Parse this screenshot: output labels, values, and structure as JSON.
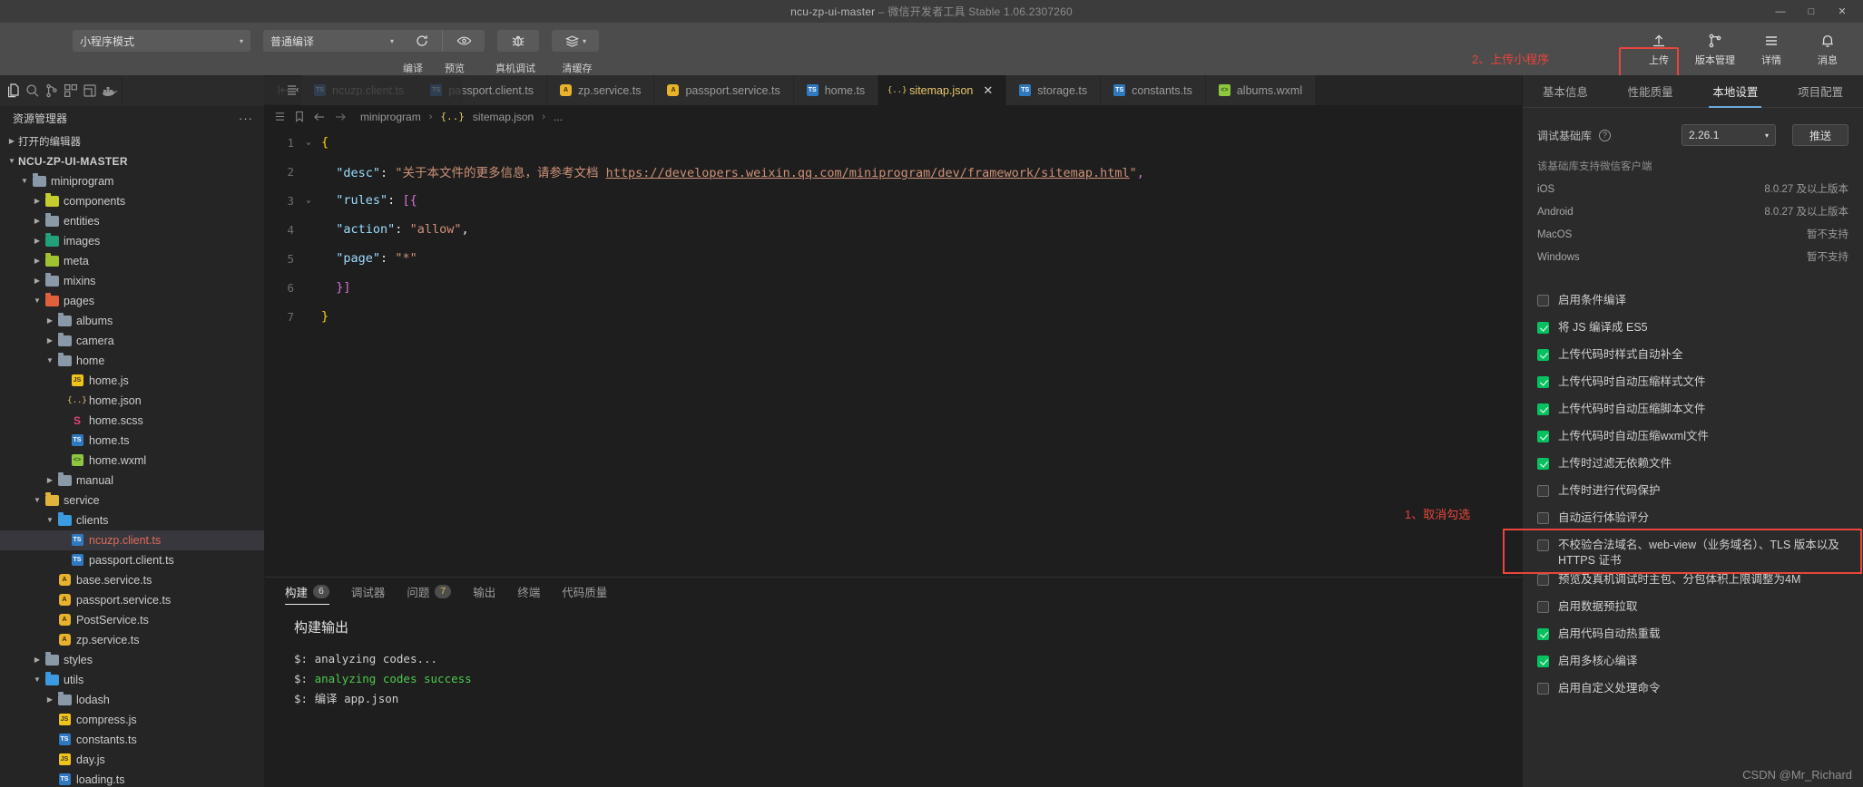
{
  "window": {
    "title_main": "ncu-zp-ui-master",
    "title_dash": " – ",
    "title_sub": "微信开发者工具 Stable 1.06.2307260",
    "minimize": "—",
    "maximize": "□",
    "close": "✕"
  },
  "toolbar": {
    "mode_select": "小程序模式",
    "compile_select": "普通编译",
    "caret": "▾",
    "labels": {
      "compile": "编译",
      "preview": "预览",
      "real_device": "真机调试",
      "clear_cache": "清缓存"
    },
    "annotation_upload": "2、上传小程序",
    "right_items": [
      {
        "icon": "upload-icon",
        "label": "上传"
      },
      {
        "icon": "branch-icon",
        "label": "版本管理"
      },
      {
        "icon": "details-icon",
        "label": "详情"
      },
      {
        "icon": "bell-icon",
        "label": "消息"
      }
    ]
  },
  "activity_bar": {
    "icons": [
      "files-icon",
      "search-icon",
      "source-control-icon",
      "extensions-icon",
      "debug-icon",
      "docker-icon",
      "collapse-all-icon"
    ]
  },
  "explorer": {
    "title": "资源管理器",
    "more": "···",
    "open_editors": "打开的编辑器",
    "root": "NCU-ZP-UI-MASTER",
    "tree": [
      {
        "label": "miniprogram",
        "depth": 1,
        "type": "folder",
        "state": "open",
        "color": "#8a99a8"
      },
      {
        "label": "components",
        "depth": 2,
        "type": "folder",
        "state": "closed",
        "color": "#c5cc2e"
      },
      {
        "label": "entities",
        "depth": 2,
        "type": "folder",
        "state": "closed",
        "color": "#8a99a8"
      },
      {
        "label": "images",
        "depth": 2,
        "type": "folder",
        "state": "closed",
        "color": "#22a07a"
      },
      {
        "label": "meta",
        "depth": 2,
        "type": "folder",
        "state": "closed",
        "color": "#9fc22e"
      },
      {
        "label": "mixins",
        "depth": 2,
        "type": "folder",
        "state": "closed",
        "color": "#8a99a8"
      },
      {
        "label": "pages",
        "depth": 2,
        "type": "folder",
        "state": "open",
        "color": "#e0603c"
      },
      {
        "label": "albums",
        "depth": 3,
        "type": "folder",
        "state": "closed",
        "color": "#8a99a8"
      },
      {
        "label": "camera",
        "depth": 3,
        "type": "folder",
        "state": "closed",
        "color": "#8a99a8"
      },
      {
        "label": "home",
        "depth": 3,
        "type": "folder",
        "state": "open",
        "color": "#8a99a8"
      },
      {
        "label": "home.js",
        "depth": 4,
        "type": "file",
        "ext": "js"
      },
      {
        "label": "home.json",
        "depth": 4,
        "type": "file",
        "ext": "json"
      },
      {
        "label": "home.scss",
        "depth": 4,
        "type": "file",
        "ext": "scss"
      },
      {
        "label": "home.ts",
        "depth": 4,
        "type": "file",
        "ext": "ts"
      },
      {
        "label": "home.wxml",
        "depth": 4,
        "type": "file",
        "ext": "wxml"
      },
      {
        "label": "manual",
        "depth": 3,
        "type": "folder",
        "state": "closed",
        "color": "#8a99a8"
      },
      {
        "label": "service",
        "depth": 2,
        "type": "folder",
        "state": "open",
        "color": "#e2b33c"
      },
      {
        "label": "clients",
        "depth": 3,
        "type": "folder",
        "state": "open",
        "color": "#3c9ae0"
      },
      {
        "label": "ncuzp.client.ts",
        "depth": 4,
        "type": "file",
        "ext": "ts",
        "selected": true
      },
      {
        "label": "passport.client.ts",
        "depth": 4,
        "type": "file",
        "ext": "ts"
      },
      {
        "label": "base.service.ts",
        "depth": 3,
        "type": "file",
        "ext": "a"
      },
      {
        "label": "passport.service.ts",
        "depth": 3,
        "type": "file",
        "ext": "a"
      },
      {
        "label": "PostService.ts",
        "depth": 3,
        "type": "file",
        "ext": "a"
      },
      {
        "label": "zp.service.ts",
        "depth": 3,
        "type": "file",
        "ext": "a"
      },
      {
        "label": "styles",
        "depth": 2,
        "type": "folder",
        "state": "closed",
        "color": "#8a99a8"
      },
      {
        "label": "utils",
        "depth": 2,
        "type": "folder",
        "state": "open",
        "color": "#3c9ae0"
      },
      {
        "label": "lodash",
        "depth": 3,
        "type": "folder",
        "state": "closed",
        "color": "#8a99a8"
      },
      {
        "label": "compress.js",
        "depth": 3,
        "type": "file",
        "ext": "js"
      },
      {
        "label": "constants.ts",
        "depth": 3,
        "type": "file",
        "ext": "ts"
      },
      {
        "label": "day.js",
        "depth": 3,
        "type": "file",
        "ext": "js"
      },
      {
        "label": "loading.ts",
        "depth": 3,
        "type": "file",
        "ext": "ts"
      }
    ]
  },
  "editor": {
    "tabs": [
      {
        "label": "ncuzp.client.ts",
        "ext": "ts",
        "active": false
      },
      {
        "label": "passport.client.ts",
        "ext": "ts",
        "active": false
      },
      {
        "label": "zp.service.ts",
        "ext": "a",
        "active": false
      },
      {
        "label": "passport.service.ts",
        "ext": "a",
        "active": false
      },
      {
        "label": "home.ts",
        "ext": "ts",
        "active": false
      },
      {
        "label": "sitemap.json",
        "ext": "json",
        "active": true,
        "close": "✕"
      },
      {
        "label": "storage.ts",
        "ext": "ts",
        "active": false
      },
      {
        "label": "constants.ts",
        "ext": "ts",
        "active": false
      },
      {
        "label": "albums.wxml",
        "ext": "wxml",
        "active": false
      }
    ],
    "breadcrumb": {
      "folder": "miniprogram",
      "file": "sitemap.json",
      "tail": "...",
      "sep": "›"
    },
    "lines": [
      {
        "n": "1",
        "fold": "⌄",
        "segments": [
          {
            "t": "{",
            "c": "k-brk"
          }
        ]
      },
      {
        "n": "2",
        "fold": "",
        "segments": [
          {
            "t": "  ",
            "c": "k-pun"
          },
          {
            "t": "\"desc\"",
            "c": "k-key"
          },
          {
            "t": ": ",
            "c": "k-pun"
          },
          {
            "t": "\"关于本文件的更多信息，请参考文档 ",
            "c": "k-str"
          },
          {
            "t": "https://developers.weixin.qq.com/miniprogram/dev/framework/sitemap.html",
            "c": "k-link"
          },
          {
            "t": "\"",
            "c": "k-str"
          },
          {
            "t": ",",
            "c": "k-brk2"
          }
        ]
      },
      {
        "n": "3",
        "fold": "⌄",
        "segments": [
          {
            "t": "  ",
            "c": "k-pun"
          },
          {
            "t": "\"rules\"",
            "c": "k-key"
          },
          {
            "t": ": ",
            "c": "k-pun"
          },
          {
            "t": "[{",
            "c": "k-brk2"
          }
        ]
      },
      {
        "n": "4",
        "fold": "",
        "segments": [
          {
            "t": "  ",
            "c": "k-pun"
          },
          {
            "t": "\"action\"",
            "c": "k-key"
          },
          {
            "t": ": ",
            "c": "k-pun"
          },
          {
            "t": "\"allow\"",
            "c": "k-str"
          },
          {
            "t": ",",
            "c": "k-pun"
          }
        ]
      },
      {
        "n": "5",
        "fold": "",
        "segments": [
          {
            "t": "  ",
            "c": "k-pun"
          },
          {
            "t": "\"page\"",
            "c": "k-key"
          },
          {
            "t": ": ",
            "c": "k-pun"
          },
          {
            "t": "\"*\"",
            "c": "k-str"
          }
        ]
      },
      {
        "n": "6",
        "fold": "",
        "segments": [
          {
            "t": "  ",
            "c": "k-pun"
          },
          {
            "t": "}]",
            "c": "k-brk2"
          }
        ]
      },
      {
        "n": "7",
        "fold": "",
        "segments": [
          {
            "t": "}",
            "c": "k-brk"
          }
        ]
      }
    ]
  },
  "panel": {
    "tabs": [
      {
        "label": "构建",
        "badge": "6",
        "active": true,
        "warn": false
      },
      {
        "label": "调试器",
        "badge": "",
        "active": false,
        "warn": false
      },
      {
        "label": "问题",
        "badge": "7",
        "active": false,
        "warn": true
      },
      {
        "label": "输出",
        "badge": "",
        "active": false,
        "warn": false
      },
      {
        "label": "终端",
        "badge": "",
        "active": false,
        "warn": false
      },
      {
        "label": "代码质量",
        "badge": "",
        "active": false,
        "warn": false
      }
    ],
    "output_title": "构建输出",
    "log_lines": [
      {
        "prefix": "$:",
        "text": " analyzing codes...",
        "ok": false
      },
      {
        "prefix": "$:",
        "text": " analyzing codes success",
        "ok": true
      },
      {
        "prefix": "$:",
        "text": " 编译 app.json",
        "ok": false
      }
    ]
  },
  "right_panel": {
    "tabs": [
      {
        "label": "基本信息",
        "active": false
      },
      {
        "label": "性能质量",
        "active": false
      },
      {
        "label": "本地设置",
        "active": true
      },
      {
        "label": "项目配置",
        "active": false
      }
    ],
    "debug_lib_label": "调试基础库",
    "help_icon": "?",
    "version": "2.26.1",
    "caret": "▾",
    "push_button": "推送",
    "support_note": "该基础库支持微信客户端",
    "os_rows": [
      {
        "os": "iOS",
        "value": "8.0.27 及以上版本"
      },
      {
        "os": "Android",
        "value": "8.0.27 及以上版本"
      },
      {
        "os": "MacOS",
        "value": "暂不支持"
      },
      {
        "os": "Windows",
        "value": "暂不支持"
      }
    ],
    "annotation_uncheck": "1、取消勾选",
    "checkboxes": [
      {
        "label": "启用条件编译",
        "checked": false
      },
      {
        "label": "将 JS 编译成 ES5",
        "checked": true
      },
      {
        "label": "上传代码时样式自动补全",
        "checked": true
      },
      {
        "label": "上传代码时自动压缩样式文件",
        "checked": true
      },
      {
        "label": "上传代码时自动压缩脚本文件",
        "checked": true
      },
      {
        "label": "上传代码时自动压缩wxml文件",
        "checked": true
      },
      {
        "label": "上传时过滤无依赖文件",
        "checked": true
      },
      {
        "label": "上传时进行代码保护",
        "checked": false
      },
      {
        "label": "自动运行体验评分",
        "checked": false
      },
      {
        "label": "不校验合法域名、web-view（业务域名）、TLS 版本以及 HTTPS 证书",
        "checked": false,
        "highlighted": true
      },
      {
        "label": "预览及真机调试时主包、分包体积上限调整为4M",
        "checked": false
      },
      {
        "label": "启用数据预拉取",
        "checked": false
      },
      {
        "label": "启用代码自动热重载",
        "checked": true
      },
      {
        "label": "启用多核心编译",
        "checked": true
      },
      {
        "label": "启用自定义处理命令",
        "checked": false
      }
    ]
  },
  "watermark": "CSDN @Mr_Richard"
}
